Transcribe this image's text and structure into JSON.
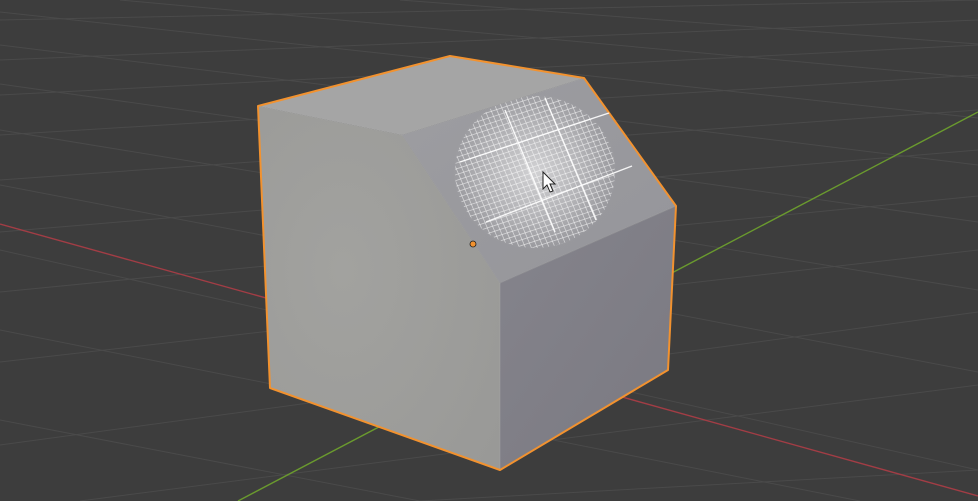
{
  "viewport": {
    "background_color": "#3d3d3d",
    "grid_line_color": "#4a4a4a",
    "x_axis_color": "#a23d45",
    "y_axis_color": "#6a9a2e"
  },
  "object": {
    "type": "cube-mesh",
    "selected": true,
    "outline_color": "#f2922f",
    "origin_color": "#f2922f",
    "face_colors": {
      "top": "#a5a5a5",
      "bevel": "#9b9b9f",
      "front": "#9e9e9c",
      "right": "#7f7e86"
    }
  },
  "sculpt_brush": {
    "icon": "brush-grid-icon",
    "color": "#ffffff"
  },
  "cursor": {
    "icon": "mouse-pointer-icon"
  }
}
